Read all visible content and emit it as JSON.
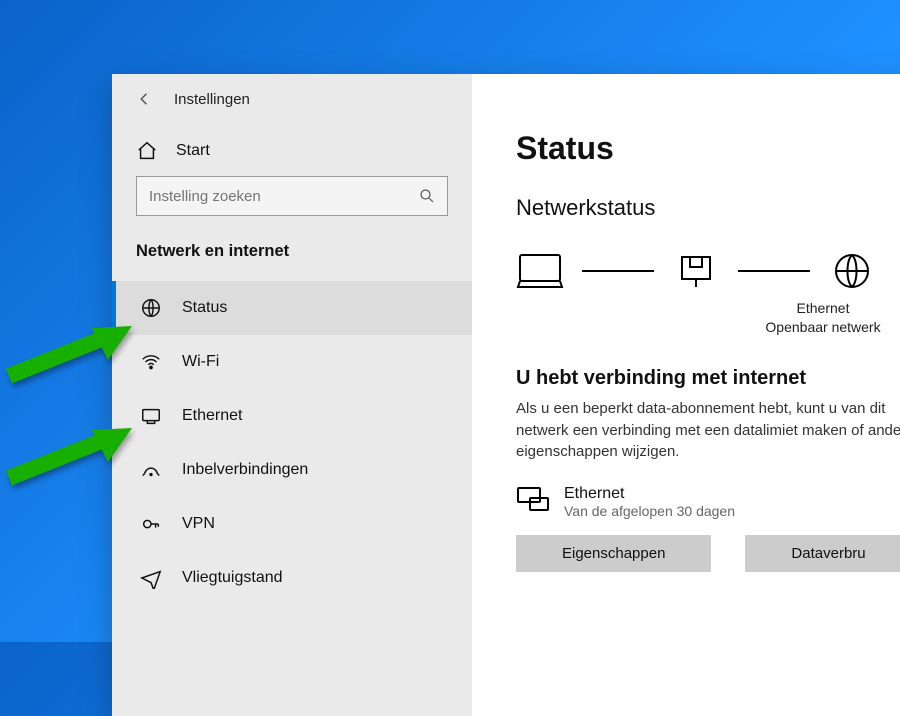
{
  "titlebar": {
    "title": "Instellingen"
  },
  "home": {
    "label": "Start"
  },
  "search": {
    "placeholder": "Instelling zoeken"
  },
  "section": {
    "heading": "Netwerk en internet"
  },
  "nav": {
    "items": [
      {
        "label": "Status"
      },
      {
        "label": "Wi-Fi"
      },
      {
        "label": "Ethernet"
      },
      {
        "label": "Inbelverbindingen"
      },
      {
        "label": "VPN"
      },
      {
        "label": "Vliegtuigstand"
      }
    ]
  },
  "content": {
    "h1": "Status",
    "h2": "Netwerkstatus",
    "diagram": {
      "mid_label_line1": "Ethernet",
      "mid_label_line2": "Openbaar netwerk"
    },
    "headline": "U hebt verbinding met internet",
    "desc": "Als u een beperkt data-abonnement hebt, kunt u van dit netwerk een verbinding met een datalimiet maken of andere eigenschappen wijzigen.",
    "net": {
      "name": "Ethernet",
      "sub": "Van de afgelopen 30 dagen"
    },
    "buttons": {
      "props": "Eigenschappen",
      "usage": "Dataverbru"
    }
  }
}
